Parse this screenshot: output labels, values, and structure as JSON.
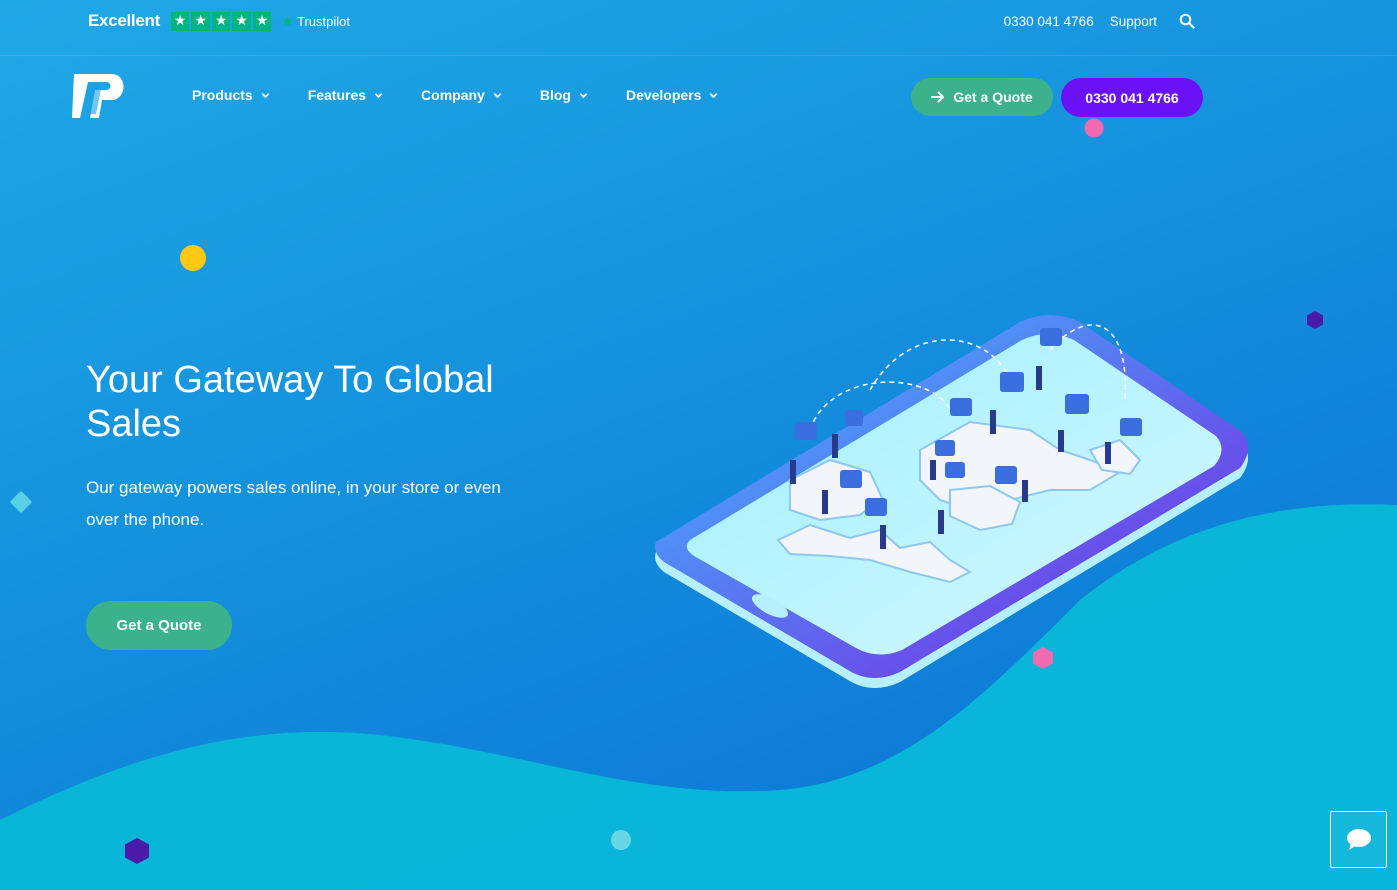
{
  "trustpilot": {
    "rating_label": "Excellent",
    "stars": 5,
    "brand": "Trustpilot",
    "star_color": "#00b67a"
  },
  "topbar": {
    "phone": "0330 041 4766",
    "support": "Support",
    "search_icon": "search-icon"
  },
  "nav": {
    "items": [
      {
        "label": "Products"
      },
      {
        "label": "Features"
      },
      {
        "label": "Company"
      },
      {
        "label": "Blog"
      },
      {
        "label": "Developers"
      }
    ],
    "quote_button": "Get a Quote",
    "phone_button": "0330 041 4766"
  },
  "hero": {
    "title": "Your Gateway To Global Sales",
    "subtitle": "Our gateway powers sales online, in your store or even over the phone.",
    "cta": "Get a Quote"
  },
  "colors": {
    "green_button": "#3bb28c",
    "purple_button": "#6a12f5",
    "wave": "#0bbbd6"
  }
}
